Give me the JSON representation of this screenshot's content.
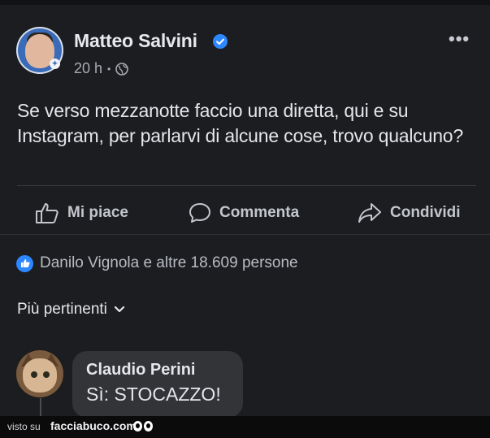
{
  "post": {
    "author": "Matteo Salvini",
    "verified": true,
    "time": "20 h",
    "separator": "•",
    "audience_icon": "globe-icon",
    "more_label": "•••",
    "text": "Se verso mezzanotte faccio una diretta, qui e su Instagram, per parlarvi di alcune cose, trovo qualcuno?"
  },
  "actions": {
    "like": "Mi piace",
    "comment": "Commenta",
    "share": "Condividi"
  },
  "reactions": {
    "text": "Danilo Vignola e altre 18.609 persone"
  },
  "sort": {
    "label": "Più pertinenti"
  },
  "comment": {
    "author": "Claudio Perini",
    "text": "Sì: STOCAZZO!"
  },
  "footer": {
    "visto_su": "visto su",
    "site": "facciabuco.com"
  },
  "colors": {
    "background": "#1c1d20",
    "text": "#e4e6eb",
    "accent": "#2d88ff"
  }
}
